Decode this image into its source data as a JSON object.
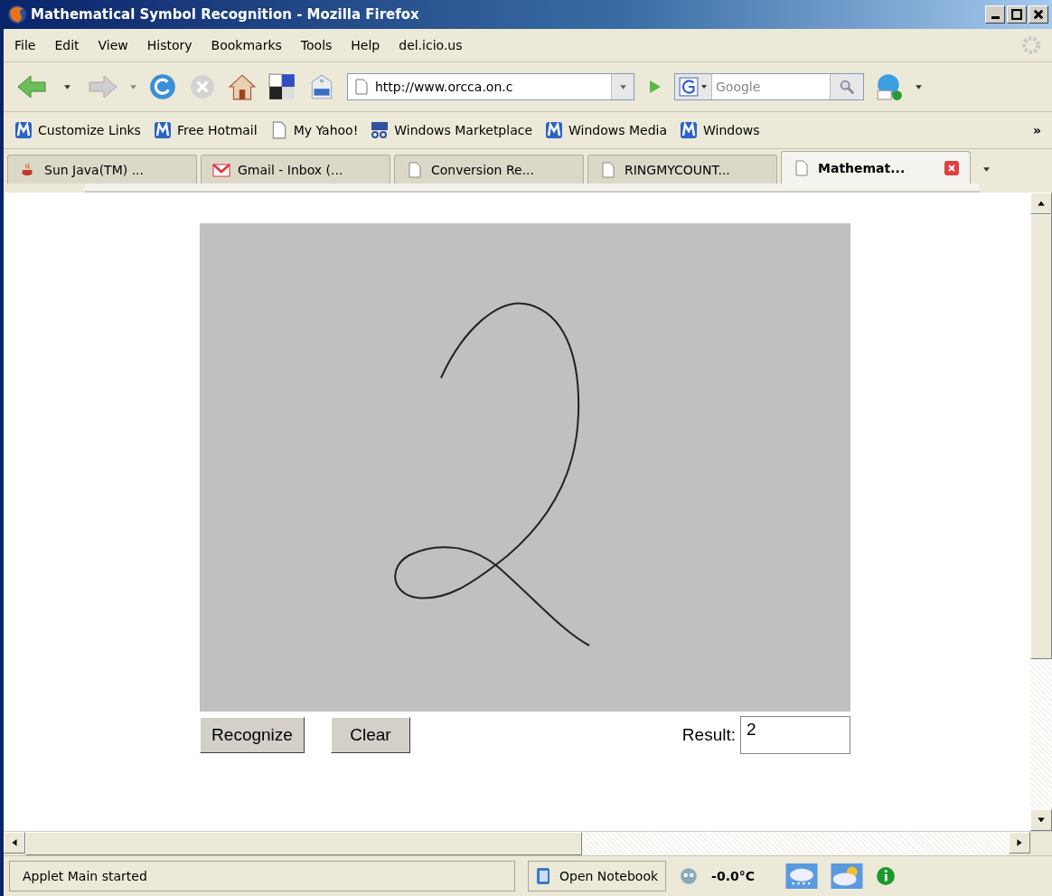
{
  "window": {
    "title": "Mathematical Symbol Recognition - Mozilla Firefox"
  },
  "menu": [
    "File",
    "Edit",
    "View",
    "History",
    "Bookmarks",
    "Tools",
    "Help",
    "del.icio.us"
  ],
  "toolbar": {
    "url": "http://www.orcca.on.c",
    "search_placeholder": "Google"
  },
  "bookmarks": [
    {
      "label": "Customize Links",
      "kind": "m"
    },
    {
      "label": "Free Hotmail",
      "kind": "m"
    },
    {
      "label": "My Yahoo!",
      "kind": "page"
    },
    {
      "label": "Windows Marketplace",
      "kind": "dmoz"
    },
    {
      "label": "Windows Media",
      "kind": "m"
    },
    {
      "label": "Windows",
      "kind": "m"
    }
  ],
  "bookmarks_overflow": "»",
  "tabs": [
    {
      "label": "Sun Java(TM) ...",
      "kind": "java",
      "selected": false
    },
    {
      "label": "Gmail - Inbox (...",
      "kind": "gmail",
      "selected": false
    },
    {
      "label": "Conversion Re...",
      "kind": "page",
      "selected": false
    },
    {
      "label": "RINGMYCOUNT...",
      "kind": "page",
      "selected": false
    },
    {
      "label": "Mathemat...",
      "kind": "page",
      "selected": true
    }
  ],
  "applet": {
    "buttons": [
      "Recognize",
      "Clear"
    ],
    "result_label": "Result:",
    "result_value": "2"
  },
  "status_bar": {
    "text": "Applet Main started",
    "notebook": "Open Notebook",
    "temperature": "-0.0°C"
  }
}
